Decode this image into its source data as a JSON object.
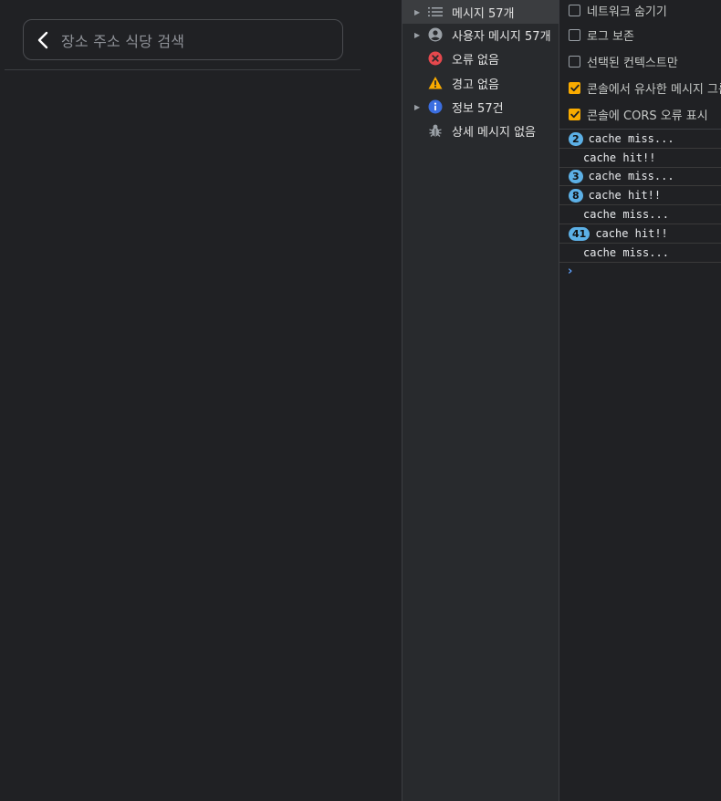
{
  "app": {
    "search_placeholder": "장소 주소 식당 검색"
  },
  "sidebar": {
    "items": [
      {
        "label": "메시지 57개",
        "icon": "list-icon",
        "expandable": true,
        "selected": true
      },
      {
        "label": "사용자 메시지 57개",
        "icon": "user-circle-icon",
        "expandable": true,
        "selected": false
      },
      {
        "label": "오류 없음",
        "icon": "error-icon",
        "expandable": false,
        "selected": false
      },
      {
        "label": "경고 없음",
        "icon": "warning-icon",
        "expandable": false,
        "selected": false
      },
      {
        "label": "정보 57건",
        "icon": "info-icon",
        "expandable": true,
        "selected": false
      },
      {
        "label": "상세 메시지 없음",
        "icon": "bug-icon",
        "expandable": false,
        "selected": false
      }
    ]
  },
  "console": {
    "settings": [
      {
        "label": "네트워크 숨기기",
        "checked": false
      },
      {
        "label": "로그 보존",
        "checked": false
      },
      {
        "label": "선택된 컨텍스트만",
        "checked": false
      },
      {
        "label": "콘솔에서 유사한 메시지 그룹",
        "checked": true
      },
      {
        "label": "콘솔에 CORS 오류 표시",
        "checked": true
      }
    ],
    "logs": [
      {
        "count": "2",
        "text": "cache miss..."
      },
      {
        "count": "",
        "text": "cache hit!!"
      },
      {
        "count": "3",
        "text": "cache miss..."
      },
      {
        "count": "8",
        "text": "cache hit!!"
      },
      {
        "count": "",
        "text": "cache miss..."
      },
      {
        "count": "41",
        "text": "cache hit!!"
      },
      {
        "count": "",
        "text": "cache miss..."
      }
    ],
    "prompt_symbol": "›"
  },
  "colors": {
    "background": "#202124",
    "sidebar_bg": "#282a2d",
    "checkbox_checked": "#f9ab00",
    "badge": "#5cb0e6",
    "error": "#e5484d",
    "warning": "#f9ab00",
    "info": "#3b6ee0"
  }
}
